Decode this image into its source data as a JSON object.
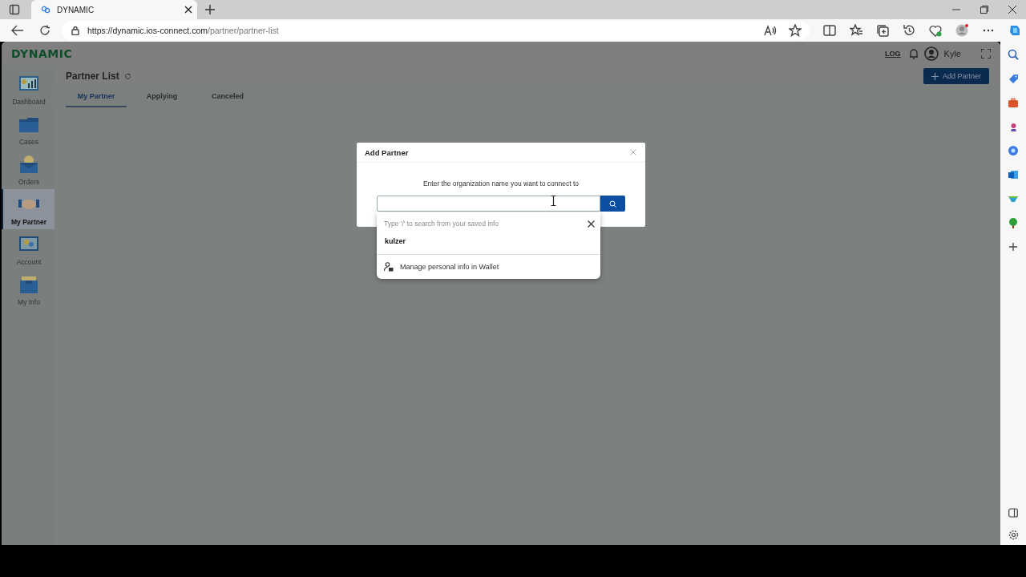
{
  "browser": {
    "tab_title": "DYNAMIC",
    "url_host": "https://dynamic.ios-connect.com",
    "url_path": "/partner/partner-list"
  },
  "app": {
    "logo": "DYNAMIC",
    "log_label": "LOG",
    "user": "Kyle",
    "sidebar": {
      "items": [
        {
          "label": "Dashboard",
          "selected": false
        },
        {
          "label": "Cases",
          "selected": false
        },
        {
          "label": "Orders",
          "selected": false
        },
        {
          "label": "My Partner",
          "selected": true
        },
        {
          "label": "Account",
          "selected": false
        },
        {
          "label": "My Info",
          "selected": false
        }
      ]
    },
    "page_title": "Partner List",
    "add_button": "Add Partner",
    "tabs": [
      {
        "label": "My Partner",
        "selected": true
      },
      {
        "label": "Applying",
        "selected": false
      },
      {
        "label": "Canceled",
        "selected": false
      }
    ]
  },
  "dialog": {
    "title": "Add Partner",
    "prompt": "Enter the organization name you want to connect to",
    "autofill": {
      "hint": "Type '/' to search from your saved info",
      "suggestions": [
        "kulzer"
      ],
      "manage": "Manage personal info in Wallet"
    }
  }
}
